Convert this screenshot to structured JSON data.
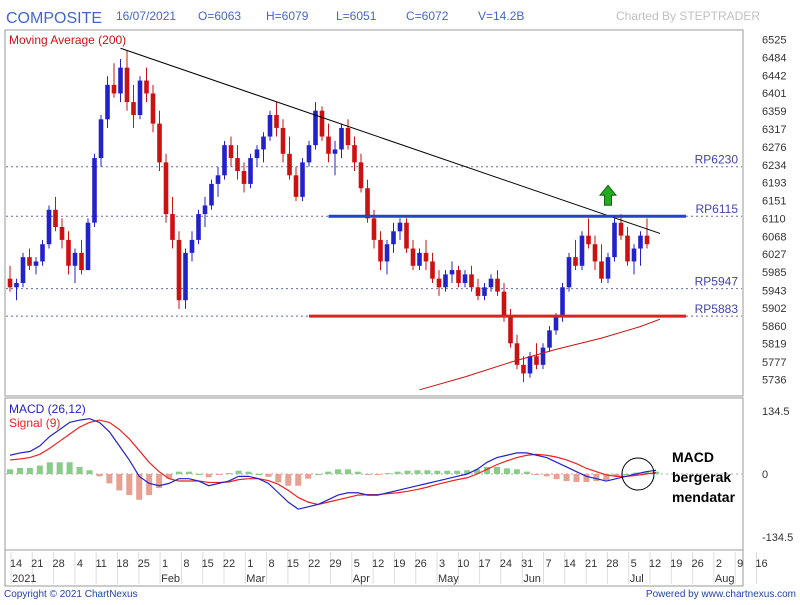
{
  "header": {
    "symbol": "COMPOSITE",
    "date": "16/07/2021",
    "open": "O=6063",
    "high": "H=6079",
    "low": "L=6051",
    "close": "C=6072",
    "volume": "V=14.2B",
    "credit": "Charted By STEPTRADER"
  },
  "footer": {
    "copyright": "Copyright © 2021 ChartNexus",
    "powered": "Powered by www.chartnexus.com"
  },
  "annotation": {
    "macd_note_lines": [
      "MACD",
      "bergerak",
      "mendatar"
    ]
  },
  "colors": {
    "bull": "#2222cc",
    "bear": "#cc1111",
    "ma": "#cc1111",
    "macd": "#2222cc",
    "signal": "#ee2222",
    "hist_pos": "#88cc88",
    "hist_neg": "#e8a090",
    "resistance": "#2244cc",
    "support": "#dd2222",
    "trendline": "#000000",
    "arrow": "#22aa22",
    "label_blue": "#4444aa"
  },
  "chart_data": [
    {
      "type": "candlestick",
      "panel": "price",
      "title": "Moving Average (200)",
      "x_ticks": [
        "14",
        "21",
        "28",
        "4",
        "11",
        "18",
        "25",
        "1",
        "8",
        "15",
        "22",
        "1",
        "8",
        "15",
        "22",
        "29",
        "5",
        "12",
        "19",
        "26",
        "3",
        "10",
        "17",
        "24",
        "31",
        "7",
        "14",
        "21",
        "28",
        "5",
        "12",
        "19",
        "26",
        "2",
        "9",
        "16"
      ],
      "x_groups": [
        "2021",
        "Feb",
        "Mar",
        "Apr",
        "May",
        "Jun",
        "Jul",
        "Aug"
      ],
      "y_ticks": [
        6525,
        6484,
        6442,
        6401,
        6359,
        6317,
        6276,
        6234,
        6193,
        6151,
        6110,
        6068,
        6027,
        5985,
        5943,
        5902,
        5860,
        5819,
        5777,
        5736
      ],
      "ylim": [
        5700,
        6545
      ],
      "levels": [
        {
          "label": "RP6230",
          "value": 6230,
          "style": "dotted"
        },
        {
          "label": "RP6115",
          "value": 6115,
          "style": "dotted"
        },
        {
          "label": "RP5947",
          "value": 5947,
          "style": "dotted"
        },
        {
          "label": "RP5883",
          "value": 5883,
          "style": "dotted"
        }
      ],
      "resistance_line": {
        "value": 6115,
        "start_index": 49,
        "end_index": 104
      },
      "support_line": {
        "value": 5883,
        "start_index": 46,
        "end_index": 104
      },
      "trendline": {
        "start": {
          "index": 17,
          "value": 6505
        },
        "end": {
          "index": 100,
          "value": 6075
        }
      },
      "ma200": [
        {
          "index": 63,
          "value": 5712
        },
        {
          "index": 70,
          "value": 5742
        },
        {
          "index": 77,
          "value": 5776
        },
        {
          "index": 84,
          "value": 5806
        },
        {
          "index": 91,
          "value": 5832
        },
        {
          "index": 97,
          "value": 5859
        },
        {
          "index": 100,
          "value": 5876
        }
      ],
      "arrow": {
        "index": 92,
        "value": 6145,
        "direction": "up"
      },
      "candles": [
        [
          5970,
          6000,
          5940,
          5950
        ],
        [
          5950,
          5970,
          5920,
          5960
        ],
        [
          5960,
          6030,
          5950,
          6020
        ],
        [
          6020,
          6040,
          5990,
          6000
        ],
        [
          6000,
          6020,
          5980,
          6010
        ],
        [
          6010,
          6060,
          6000,
          6050
        ],
        [
          6050,
          6140,
          6040,
          6130
        ],
        [
          6130,
          6160,
          6080,
          6090
        ],
        [
          6090,
          6110,
          6040,
          6060
        ],
        [
          6060,
          6080,
          5980,
          6000
        ],
        [
          6000,
          6040,
          5960,
          6030
        ],
        [
          6030,
          6060,
          5980,
          5990
        ],
        [
          5990,
          6110,
          5990,
          6100
        ],
        [
          6100,
          6260,
          6090,
          6250
        ],
        [
          6250,
          6350,
          6230,
          6340
        ],
        [
          6340,
          6440,
          6320,
          6420
        ],
        [
          6420,
          6470,
          6390,
          6400
        ],
        [
          6400,
          6480,
          6380,
          6460
        ],
        [
          6460,
          6500,
          6360,
          6380
        ],
        [
          6380,
          6420,
          6320,
          6350
        ],
        [
          6350,
          6440,
          6340,
          6430
        ],
        [
          6430,
          6460,
          6380,
          6400
        ],
        [
          6400,
          6420,
          6310,
          6330
        ],
        [
          6330,
          6360,
          6220,
          6240
        ],
        [
          6240,
          6260,
          6100,
          6120
        ],
        [
          6120,
          6160,
          6040,
          6060
        ],
        [
          6060,
          6080,
          5900,
          5920
        ],
        [
          5920,
          6040,
          5900,
          6030
        ],
        [
          6030,
          6080,
          6010,
          6060
        ],
        [
          6060,
          6130,
          6050,
          6120
        ],
        [
          6120,
          6160,
          6090,
          6140
        ],
        [
          6140,
          6200,
          6130,
          6190
        ],
        [
          6190,
          6230,
          6160,
          6210
        ],
        [
          6210,
          6290,
          6200,
          6280
        ],
        [
          6280,
          6300,
          6230,
          6250
        ],
        [
          6250,
          6280,
          6200,
          6220
        ],
        [
          6220,
          6240,
          6170,
          6190
        ],
        [
          6190,
          6260,
          6180,
          6250
        ],
        [
          6250,
          6280,
          6230,
          6270
        ],
        [
          6270,
          6310,
          6240,
          6300
        ],
        [
          6300,
          6360,
          6290,
          6350
        ],
        [
          6350,
          6380,
          6300,
          6320
        ],
        [
          6320,
          6340,
          6240,
          6260
        ],
        [
          6260,
          6300,
          6200,
          6210
        ],
        [
          6210,
          6230,
          6150,
          6160
        ],
        [
          6160,
          6250,
          6150,
          6240
        ],
        [
          6240,
          6290,
          6230,
          6280
        ],
        [
          6280,
          6380,
          6270,
          6360
        ],
        [
          6360,
          6370,
          6290,
          6300
        ],
        [
          6300,
          6330,
          6240,
          6260
        ],
        [
          6260,
          6290,
          6210,
          6270
        ],
        [
          6270,
          6330,
          6250,
          6320
        ],
        [
          6320,
          6340,
          6270,
          6280
        ],
        [
          6280,
          6300,
          6220,
          6240
        ],
        [
          6240,
          6260,
          6170,
          6180
        ],
        [
          6180,
          6200,
          6100,
          6110
        ],
        [
          6110,
          6130,
          6040,
          6060
        ],
        [
          6060,
          6080,
          5990,
          6010
        ],
        [
          6010,
          6060,
          5980,
          6050
        ],
        [
          6050,
          6100,
          6030,
          6080
        ],
        [
          6080,
          6110,
          6060,
          6100
        ],
        [
          6100,
          6110,
          6030,
          6040
        ],
        [
          6040,
          6060,
          5990,
          6000
        ],
        [
          6000,
          6040,
          5990,
          6030
        ],
        [
          6030,
          6060,
          5990,
          6010
        ],
        [
          6010,
          6030,
          5960,
          5970
        ],
        [
          5970,
          5990,
          5930,
          5950
        ],
        [
          5950,
          5990,
          5940,
          5980
        ],
        [
          5980,
          6010,
          5960,
          5990
        ],
        [
          5990,
          6000,
          5950,
          5960
        ],
        [
          5960,
          5990,
          5950,
          5980
        ],
        [
          5980,
          6000,
          5940,
          5950
        ],
        [
          5950,
          5970,
          5920,
          5930
        ],
        [
          5930,
          5960,
          5920,
          5950
        ],
        [
          5950,
          5980,
          5940,
          5970
        ],
        [
          5970,
          5990,
          5930,
          5940
        ],
        [
          5940,
          5960,
          5870,
          5880
        ],
        [
          5880,
          5900,
          5810,
          5820
        ],
        [
          5820,
          5840,
          5760,
          5770
        ],
        [
          5770,
          5790,
          5730,
          5750
        ],
        [
          5750,
          5800,
          5740,
          5790
        ],
        [
          5790,
          5820,
          5760,
          5770
        ],
        [
          5770,
          5820,
          5760,
          5810
        ],
        [
          5810,
          5860,
          5800,
          5850
        ],
        [
          5850,
          5890,
          5840,
          5880
        ],
        [
          5880,
          5960,
          5870,
          5950
        ],
        [
          5950,
          6030,
          5940,
          6020
        ],
        [
          6020,
          6060,
          5990,
          6000
        ],
        [
          6000,
          6080,
          5990,
          6070
        ],
        [
          6070,
          6110,
          6040,
          6050
        ],
        [
          6050,
          6070,
          5990,
          6010
        ],
        [
          6010,
          6050,
          5960,
          5970
        ],
        [
          5970,
          6030,
          5960,
          6020
        ],
        [
          6020,
          6110,
          6010,
          6100
        ],
        [
          6100,
          6120,
          6060,
          6070
        ],
        [
          6070,
          6090,
          6000,
          6010
        ],
        [
          6010,
          6050,
          5980,
          6040
        ],
        [
          6040,
          6080,
          6000,
          6070
        ],
        [
          6070,
          6110,
          6040,
          6050
        ]
      ]
    },
    {
      "type": "macd",
      "panel": "macd",
      "series": [
        {
          "name": "MACD (26,12)",
          "values": [
            40,
            45,
            48,
            60,
            80,
            95,
            110,
            115,
            118,
            110,
            90,
            60,
            30,
            -5,
            -20,
            -25,
            -20,
            -10,
            -10,
            -15,
            -25,
            -20,
            -15,
            -5,
            -5,
            -10,
            -20,
            -40,
            -60,
            -75,
            -70,
            -65,
            -55,
            -45,
            -40,
            -40,
            -45,
            -45,
            -40,
            -35,
            -30,
            -25,
            -20,
            -15,
            -10,
            -5,
            0,
            10,
            25,
            35,
            40,
            45,
            45,
            40,
            35,
            25,
            15,
            5,
            -5,
            -10,
            -15,
            -10,
            -5,
            0,
            5,
            8
          ]
        },
        {
          "name": "Signal (9)",
          "values": [
            30,
            32,
            35,
            42,
            55,
            70,
            85,
            100,
            110,
            115,
            110,
            95,
            75,
            50,
            25,
            5,
            -10,
            -15,
            -15,
            -15,
            -18,
            -18,
            -17,
            -12,
            -10,
            -10,
            -14,
            -22,
            -35,
            -50,
            -60,
            -65,
            -60,
            -55,
            -50,
            -45,
            -44,
            -44,
            -42,
            -40,
            -37,
            -33,
            -28,
            -22,
            -17,
            -12,
            -8,
            0,
            10,
            20,
            28,
            35,
            40,
            42,
            40,
            36,
            30,
            22,
            12,
            5,
            -2,
            -5,
            -5,
            -3,
            0,
            3
          ]
        }
      ],
      "ylim": [
        -160,
        160
      ],
      "y_ticks": [
        134.5,
        0,
        -134.5
      ]
    }
  ]
}
